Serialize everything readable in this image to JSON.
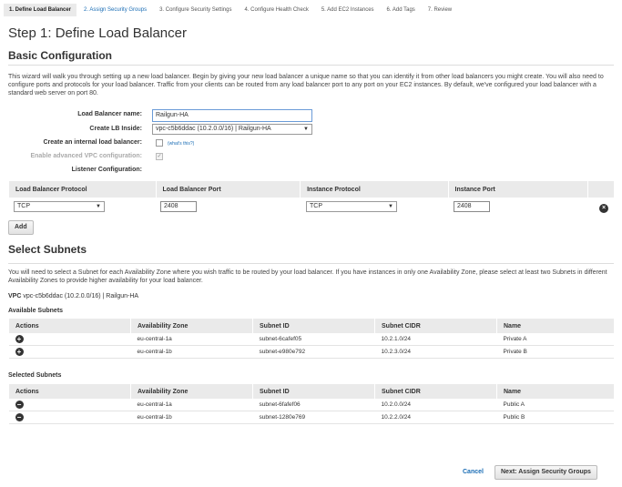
{
  "steps": [
    "1. Define Load Balancer",
    "2. Assign Security Groups",
    "3. Configure Security Settings",
    "4. Configure Health Check",
    "5. Add EC2 Instances",
    "6. Add Tags",
    "7. Review"
  ],
  "page_title": "Step 1: Define Load Balancer",
  "basic": {
    "heading": "Basic Configuration",
    "description": "This wizard will walk you through setting up a new load balancer. Begin by giving your new load balancer a unique name so that you can identify it from other load balancers you might create. You will also need to configure ports and protocols for your load balancer. Traffic from your clients can be routed from any load balancer port to any port on your EC2 instances. By default, we've configured your load balancer with a standard web server on port 80.",
    "name_label": "Load Balancer name:",
    "name_value": "Railgun-HA",
    "inside_label": "Create LB Inside:",
    "inside_value": "vpc-c5b6ddac (10.2.0.0/16) | Railgun-HA",
    "internal_label": "Create an internal load balancer:",
    "whats_this": "(what's this?)",
    "advanced_label": "Enable advanced VPC configuration:",
    "listener_label": "Listener Configuration:"
  },
  "listener": {
    "headers": [
      "Load Balancer Protocol",
      "Load Balancer Port",
      "Instance Protocol",
      "Instance Port"
    ],
    "lb_protocol": "TCP",
    "lb_port": "2408",
    "instance_protocol": "TCP",
    "instance_port": "2408",
    "add_label": "Add"
  },
  "subnets": {
    "heading": "Select Subnets",
    "description": "You will need to select a Subnet for each Availability Zone where you wish traffic to be routed by your load balancer. If you have instances in only one Availability Zone, please select at least two Subnets in different Availability Zones to provide higher availability for your load balancer.",
    "vpc_prefix": "VPC",
    "vpc_value": "vpc-c5b6ddac (10.2.0.0/16) | Railgun-HA",
    "available_label": "Available Subnets",
    "selected_label": "Selected Subnets",
    "headers": [
      "Actions",
      "Availability Zone",
      "Subnet ID",
      "Subnet CIDR",
      "Name"
    ],
    "available": [
      {
        "az": "eu-central-1a",
        "id": "subnet-6cafef05",
        "cidr": "10.2.1.0/24",
        "name": "Private A"
      },
      {
        "az": "eu-central-1b",
        "id": "subnet-e980e792",
        "cidr": "10.2.3.0/24",
        "name": "Private B"
      }
    ],
    "selected": [
      {
        "az": "eu-central-1a",
        "id": "subnet-6fafef06",
        "cidr": "10.2.0.0/24",
        "name": "Public A"
      },
      {
        "az": "eu-central-1b",
        "id": "subnet-1280e769",
        "cidr": "10.2.2.0/24",
        "name": "Public B"
      }
    ]
  },
  "footer": {
    "cancel": "Cancel",
    "next": "Next: Assign Security Groups"
  }
}
